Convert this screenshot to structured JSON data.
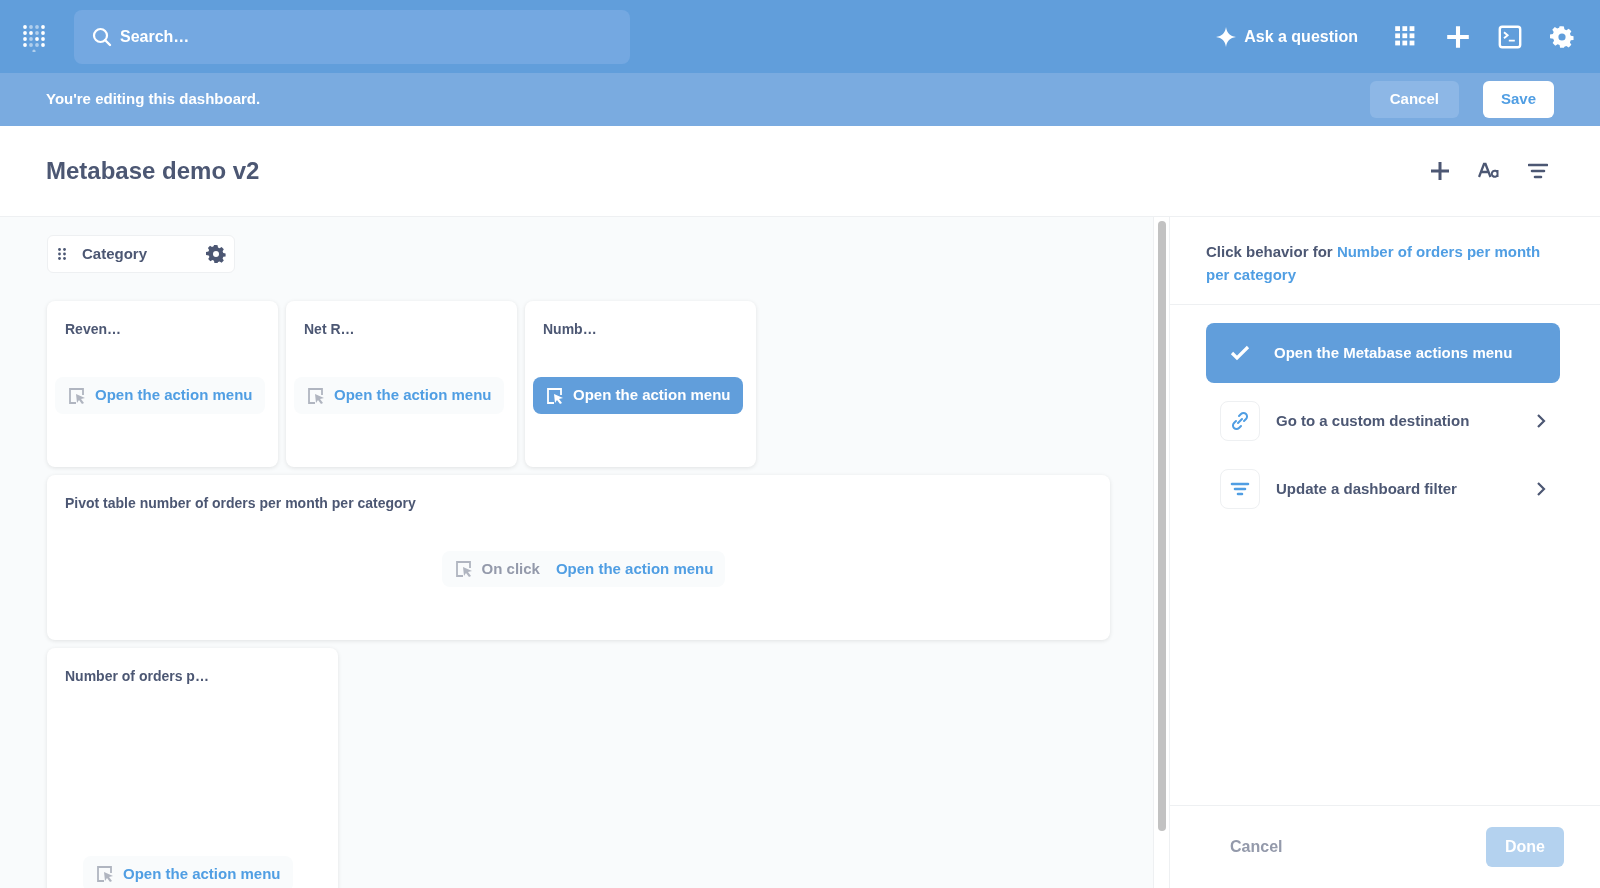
{
  "header": {
    "search": {
      "placeholder": "Search…"
    },
    "ask_button": "Ask a question"
  },
  "edit_bar": {
    "message": "You're editing this dashboard.",
    "buttons": [
      {
        "label": "Cancel",
        "kind": "secondary"
      },
      {
        "label": "Save",
        "kind": "primary"
      }
    ]
  },
  "dashboard": {
    "title": "Metabase demo v2",
    "filter": {
      "label": "Category"
    },
    "rows": [
      [
        {
          "kind": "tile",
          "title": "Reven…",
          "action": {
            "label": "Open the action menu",
            "selected": false
          }
        },
        {
          "kind": "tile",
          "title": "Net R…",
          "action": {
            "label": "Open the action menu",
            "selected": false
          }
        },
        {
          "kind": "tile",
          "title": "Numb…",
          "action": {
            "label": "Open the action menu",
            "selected": true
          }
        }
      ],
      [
        {
          "kind": "wide",
          "title": "Pivot table number of orders per month per category",
          "action": {
            "prefix": "On click",
            "label": "Open the action menu",
            "selected": false
          }
        }
      ],
      [
        {
          "kind": "tall",
          "title": "Number of orders p…",
          "action": {
            "label": "Open the action menu",
            "selected": false
          }
        }
      ]
    ]
  },
  "panel": {
    "heading_prefix": "Click behavior for",
    "heading_target": "Number of orders per month per category",
    "options": [
      {
        "kind": "check",
        "label": "Open the Metabase actions menu",
        "selected": true
      },
      {
        "kind": "link",
        "label": "Go to a custom destination",
        "selected": false
      },
      {
        "kind": "filter",
        "label": "Update a dashboard filter",
        "selected": false
      }
    ],
    "footer": {
      "cancel": "Cancel",
      "done": {
        "label": "Done",
        "disabled": true
      }
    }
  }
}
